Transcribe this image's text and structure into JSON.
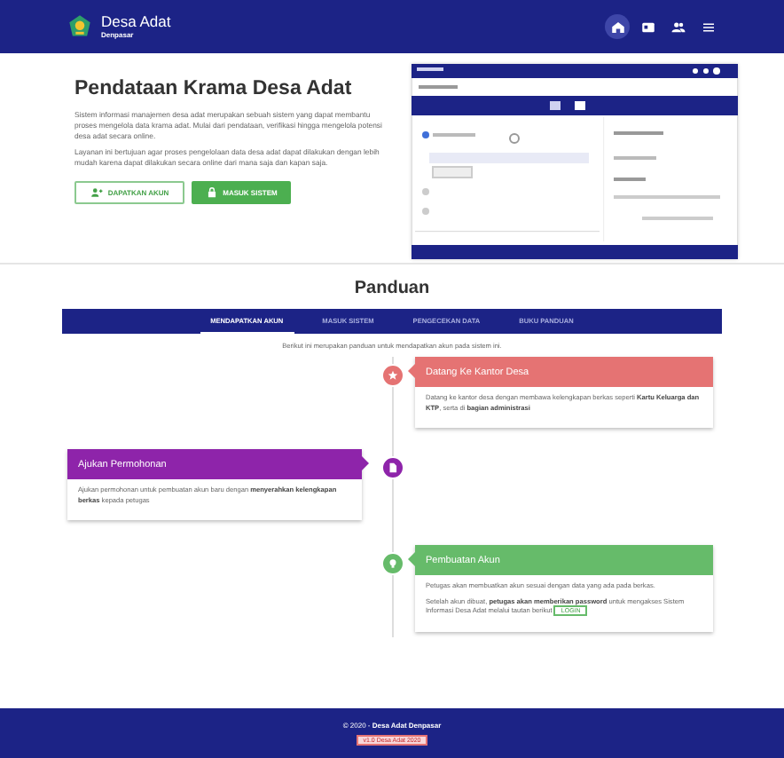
{
  "header": {
    "title": "Desa Adat",
    "subtitle": "Denpasar",
    "nav": [
      {
        "selected": true
      },
      {
        "selected": false
      },
      {
        "selected": false
      },
      {
        "selected": false
      }
    ]
  },
  "hero": {
    "title": "Pendataan Krama Desa Adat",
    "paragraphs": [
      "Sistem informasi manajemen desa adat merupakan sebuah sistem yang dapat membantu proses mengelola data krama adat. Mulai dari pendataan, verifikasi hingga mengelola potensi desa adat secara online.",
      "Layanan ini bertujuan agar proses pengelolaan data desa adat dapat dilakukan dengan lebih mudah karena dapat dilakukan secara online dari mana saja dan kapan saja."
    ],
    "buttons": [
      {
        "label": "DAPATKAN AKUN",
        "kind": "outline"
      },
      {
        "label": "MASUK SISTEM",
        "kind": "filled"
      }
    ]
  },
  "guide": {
    "title": "Panduan",
    "tabs": [
      {
        "label": "MENDAPATKAN AKUN",
        "selected": true
      },
      {
        "label": "MASUK SISTEM",
        "selected": false
      },
      {
        "label": "PENGECEKAN DATA",
        "selected": false
      },
      {
        "label": "BUKU PANDUAN",
        "selected": false
      }
    ],
    "intro": "Berikut ini merupakan panduan untuk mendapatkan akun pada sistem ini.",
    "steps": [
      {
        "color": "#e57373",
        "title": "Datang Ke Kantor Desa",
        "paragraphs": [
          "Datang ke kantor desa dengan membawa kelengkapan berkas seperti **Kartu Keluarga dan KTP**, serta di **bagian administrasi**"
        ]
      },
      {
        "color": "#8e24aa",
        "title": "Ajukan Permohonan",
        "paragraphs": [
          "Ajukan permohonan untuk pembuatan akun baru dengan **menyerahkan kelengkapan berkas** kepada petugas"
        ]
      },
      {
        "color": "#66bb6a",
        "title": "Pembuatan Akun",
        "paragraphs": [
          "Petugas akan membuatkan akun sesuai dengan data yang ada pada berkas.",
          "Setelah akun dibuat, **petugas akan memberikan password** untuk mengakses Sistem Informasi Desa Adat melalui tautan berikut"
        ],
        "link": "LOGIN"
      }
    ]
  },
  "footer": {
    "copyright": "© 2020 - **Desa Adat Denpasar**",
    "version": "v1.0 Desa Adat 2020"
  }
}
